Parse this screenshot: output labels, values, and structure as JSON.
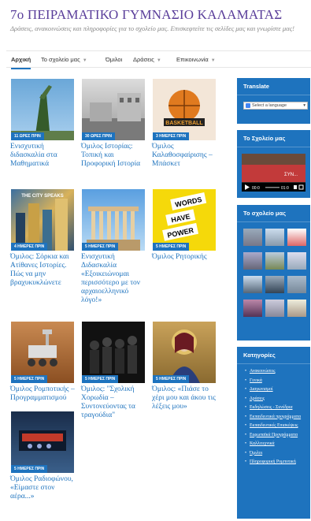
{
  "site": {
    "title": "7ο ΠΕΙΡΑΜΑΤΙΚΟ ΓΥΜΝΑΣΙΟ ΚΑΛΑΜΑΤΑΣ",
    "tagline": "Δράσεις, ανακοινώσεις και πληροφορίες για το σχολείο μας. Επισκεφτείτε τις σελίδες μας και γνωρίστε μας!"
  },
  "nav": {
    "items": [
      {
        "label": "Αρχική",
        "active": true
      },
      {
        "label": "Το σχολείο μας",
        "caret": "▼"
      },
      {
        "label": "Όμιλοι"
      },
      {
        "label": "Δράσεις",
        "caret": "▼"
      },
      {
        "label": "Επικοινωνία",
        "caret": "▼"
      }
    ]
  },
  "posts": [
    {
      "badge": "11 ΩΡΕΣ ΠΡΙΝ",
      "title": "Ενισχυτική διδασκαλία στα Μαθηματικά"
    },
    {
      "badge": "30 ΩΡΕΣ ΠΡΙΝ",
      "title": "Όμιλος Ιστορίας: Τοπική και Προφορική Ιστορία"
    },
    {
      "badge": "3 ΗΜΕΡΕΣ ΠΡΙΝ",
      "title": "Όμιλος Καλαθοσφαίρισης – Μπάσκετ",
      "image_text": "BASKETBALL"
    },
    {
      "badge": "4 ΗΜΕΡΕΣ ΠΡΙΝ",
      "title": "Όμιλος: Σόρκια και Ατίθανες Ιστορίες. Πώς να μην βραχυκυκλώνετε",
      "image_text": "THE CITY SPEAKS"
    },
    {
      "badge": "5 ΗΜΕΡΕΣ ΠΡΙΝ",
      "title": "Ενισχυτική Διδασκαλία «Εξοικειώνομαι περισσότερο με τον αρχαιοελληνικό λόγο!»"
    },
    {
      "badge": "5 ΗΜΕΡΕΣ ΠΡΙΝ",
      "title": "Όμιλος Ρητορικής",
      "image_text": [
        "WORDS",
        "HAVE",
        "POWER"
      ]
    },
    {
      "badge": "5 ΗΜΕΡΕΣ ΠΡΙΝ",
      "title": "Όμιλος Ρομποτικής – Προγραμματισμού"
    },
    {
      "badge": "5 ΗΜΕΡΕΣ ΠΡΙΝ",
      "title": "Όμιλος: \"Σχολική Χορωδία – Συντονεύοντας τα τραγούδια\""
    },
    {
      "badge": "5 ΗΜΕΡΕΣ ΠΡΙΝ",
      "title": "Όμιλος: «Πιάσε το χέρι μου και άκου τις λέξεις μου»"
    },
    {
      "badge": "5 ΗΜΕΡΕΣ ΠΡΙΝ",
      "title": "Όμιλος Ραδιοφώνου, «Είμαστε στον αέρα...»"
    }
  ],
  "sidebar": {
    "translate": {
      "title": "Translate",
      "select": "Select a language"
    },
    "school_video": {
      "title": "Το Σχολείο μας",
      "time": "00:0",
      "duration": "01:0",
      "caption": "ΣΥΝ..."
    },
    "gallery": {
      "title": "Το σχολείο μας"
    },
    "categories": {
      "title": "Κατηγορίες",
      "items": [
        "Ανακοινώσεις",
        "Γενικά",
        "Διαγωνισμοί",
        "Δράσεις",
        "Εκδηλώσεις - Συνέδρια",
        "Εκπαιδευτικά προγράμματα",
        "Εκπαιδευτικές Επισκέψεις",
        "Ευρωπαϊκά Προγράμματα",
        "Καλλιτεχνικά",
        "Όμιλοι",
        "Πληροφορική Ρομποτική"
      ]
    }
  },
  "colors": {
    "accent": "#1e73be",
    "title": "#5a3e9a"
  }
}
